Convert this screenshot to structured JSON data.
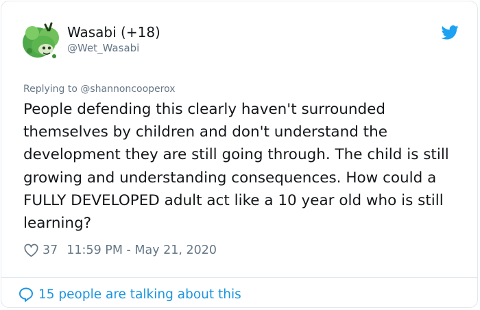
{
  "tweet": {
    "author": {
      "display_name": "Wasabi (+18)",
      "handle": "@Wet_Wasabi",
      "avatar_icon": "green-cartoon-avatar"
    },
    "platform_icon": "twitter-bird-icon",
    "reply_context": "Replying to @shannoncooperox",
    "text": "People defending this clearly haven't surrounded themselves by children and don't understand the development they are still going through. The child is still growing and understanding consequences. How could a FULLY DEVELOPED adult act like a 10 year old who is still learning?",
    "likes": "37",
    "timestamp": "11:59 PM - May 21, 2020",
    "conversation_link": "15 people are talking about this"
  },
  "colors": {
    "text_primary": "#14171a",
    "text_secondary": "#657786",
    "twitter_blue": "#1da1f2",
    "link_blue": "#1b95e0",
    "border": "#e1e8ed",
    "avatar_green": "#4fa84a"
  }
}
